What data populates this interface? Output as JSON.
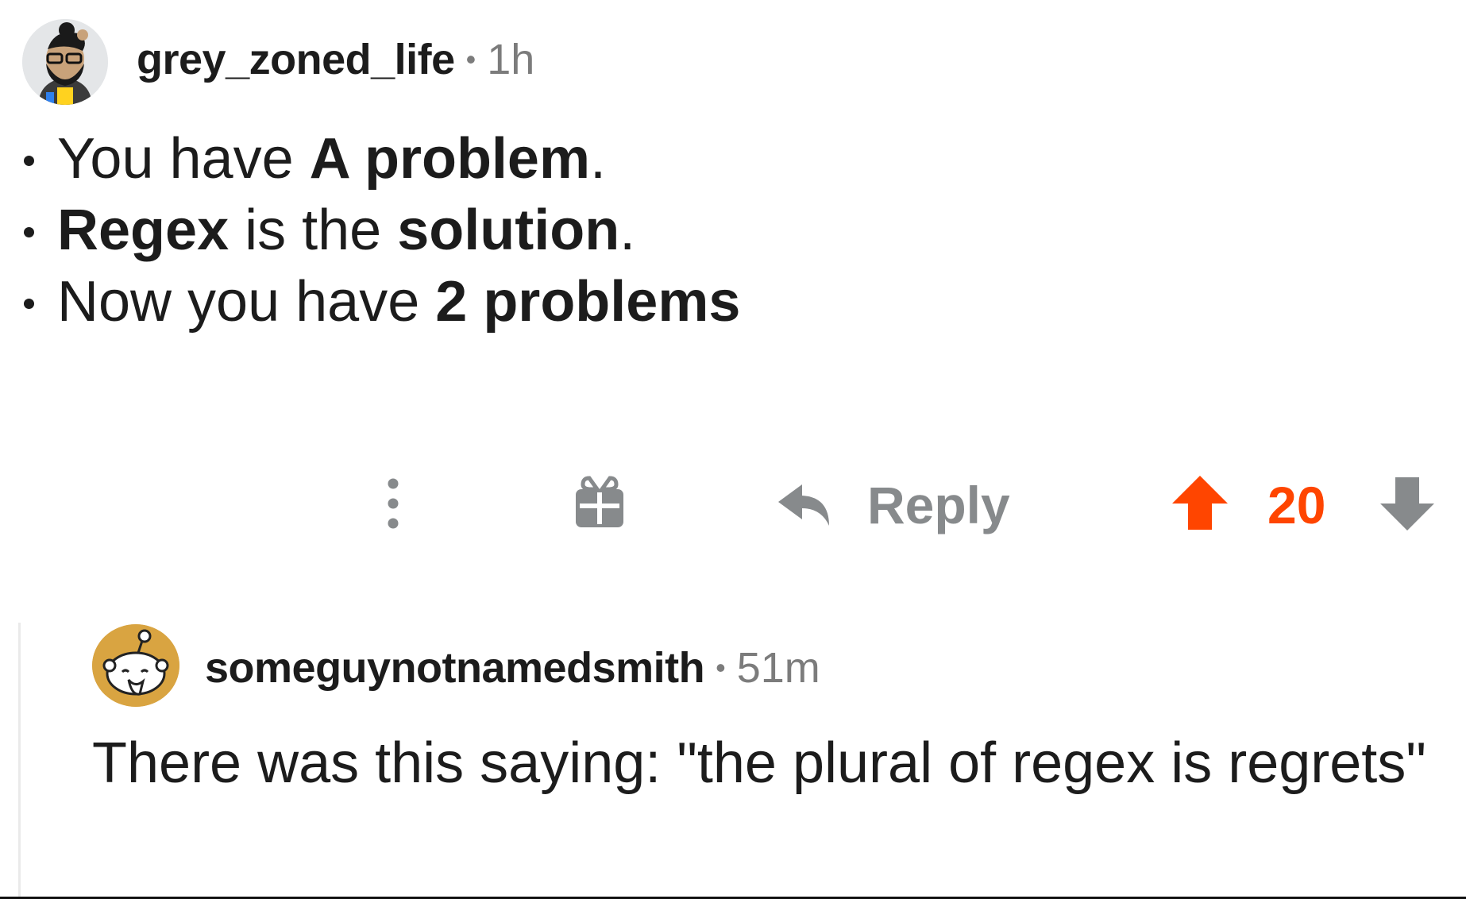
{
  "comment": {
    "username": "grey_zoned_life",
    "separator": "•",
    "time": "1h",
    "bullets": [
      [
        {
          "t": "You have ",
          "b": false
        },
        {
          "t": "A problem",
          "b": true
        },
        {
          "t": ".",
          "b": false
        }
      ],
      [
        {
          "t": "Regex",
          "b": true
        },
        {
          "t": " is the ",
          "b": false
        },
        {
          "t": "solution",
          "b": true
        },
        {
          "t": ".",
          "b": false
        }
      ],
      [
        {
          "t": "Now you have ",
          "b": false
        },
        {
          "t": "2 problems",
          "b": true
        }
      ]
    ],
    "actions": {
      "more_icon": "vertical-ellipsis-icon",
      "gift_icon": "gift-icon",
      "reply_icon": "reply-arrow-icon",
      "reply_label": "Reply",
      "upvote_icon": "upvote-arrow-icon",
      "score": "20",
      "downvote_icon": "downvote-arrow-icon"
    }
  },
  "reply": {
    "username": "someguynotnamedsmith",
    "separator": "•",
    "time": "51m",
    "body": "There was this saying: \"the plural of regex is regrets\""
  },
  "colors": {
    "upvote_active": "#ff4500",
    "icon_gray": "#878a8c",
    "meta_gray": "#7c7c7c",
    "text": "#1c1c1c"
  }
}
